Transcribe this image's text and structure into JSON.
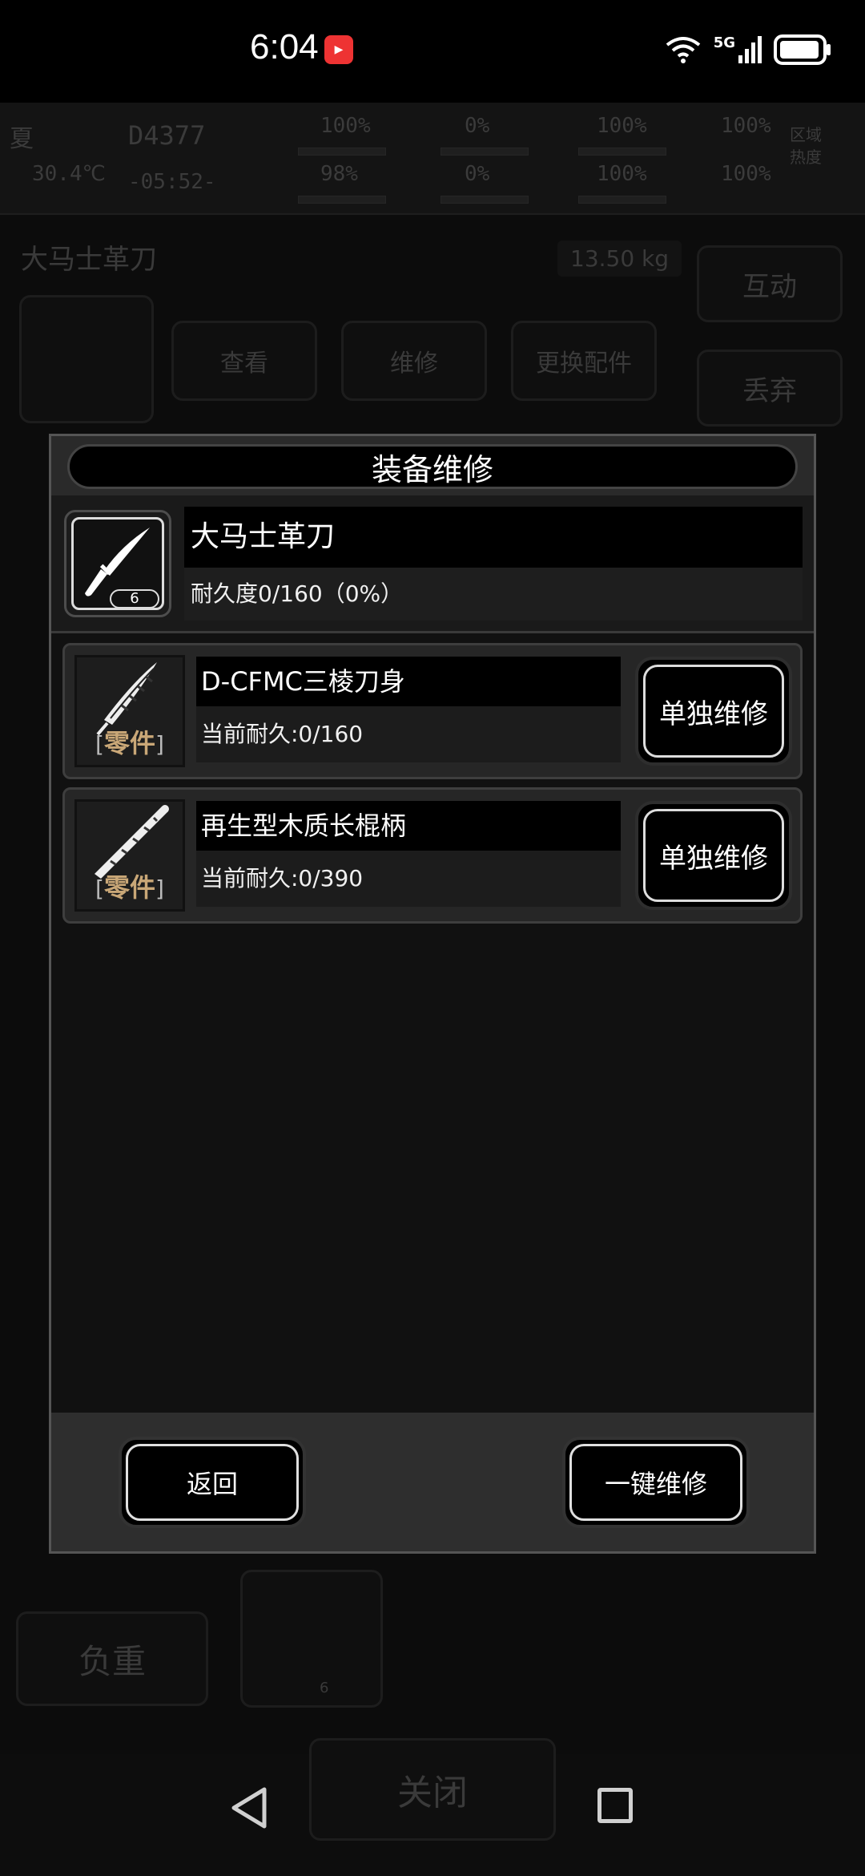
{
  "status_bar": {
    "time": "6:04",
    "network": "5G",
    "battery_icon": "battery-icon",
    "wifi_icon": "wifi-icon"
  },
  "hud": {
    "season": "夏",
    "temperature": "30.4℃",
    "day_counter": "D4377",
    "clock": "-05:52-",
    "stats_row1": [
      "100%",
      "0%",
      "100%",
      "100%"
    ],
    "stats_row2": [
      "98%",
      "0%",
      "100%",
      "100%"
    ],
    "zone_label_line1": "区域",
    "zone_label_line2": "热度"
  },
  "background": {
    "item_title": "大马士革刀",
    "weight": "13.50 kg",
    "buttons": [
      "查看",
      "维修",
      "更换配件"
    ],
    "interact_label": "互动",
    "discard_label": "丢弃",
    "load_label": "负重",
    "close_label": "关闭",
    "slot_level": "6"
  },
  "modal": {
    "title": "装备维修",
    "item": {
      "name": "大马士革刀",
      "durability": "耐久度0/160（0%）",
      "level": "6",
      "icon": "knife-icon"
    },
    "parts": [
      {
        "name": "D-CFMC三棱刀身",
        "durability": "当前耐久:0/160",
        "tag": "零件",
        "icon": "blade-part-icon",
        "repair_label": "单独维修"
      },
      {
        "name": "再生型木质长棍柄",
        "durability": "当前耐久:0/390",
        "tag": "零件",
        "icon": "handle-part-icon",
        "repair_label": "单独维修"
      }
    ],
    "back_label": "返回",
    "repair_all_label": "一键维修"
  },
  "colors": {
    "accent_gold": "#c9a777",
    "panel": "#111111",
    "border": "#555555"
  }
}
